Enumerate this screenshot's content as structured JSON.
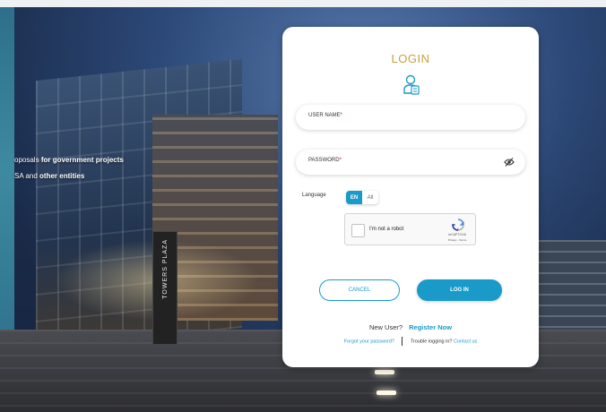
{
  "background": {
    "tagline_line1_prefix": "oposals",
    "tagline_line1_bold": "for government projects",
    "tagline_line2_prefix": "SA and",
    "tagline_line2_bold": "other entities",
    "sign_text": "TOWERS PLAZA"
  },
  "login": {
    "title": "LOGIN",
    "icon": "user-id-icon",
    "username": {
      "label": "USER NAME",
      "required_mark": "*",
      "value": ""
    },
    "password": {
      "label": "PASSWORD",
      "required_mark": "*",
      "value": "",
      "icon": "eye-icon"
    },
    "language": {
      "label": "Language",
      "options": [
        "EN",
        "All"
      ],
      "selected": "EN"
    },
    "captcha": {
      "text": "I'm not a robot",
      "brand": "reCAPTCHA",
      "links": "Privacy - Terms",
      "checked": false
    },
    "cancel_label": "CANCEL",
    "login_label": "LOG IN",
    "new_user_text": "New User?",
    "register_label": "Register Now",
    "forgot_label": "Forgot your password?",
    "trouble_text": "Trouble logging in?",
    "contact_label": "Contact us"
  },
  "colors": {
    "accent": "#1a9ac9",
    "title_gold": "#c9a23a",
    "required": "#d0021b"
  }
}
